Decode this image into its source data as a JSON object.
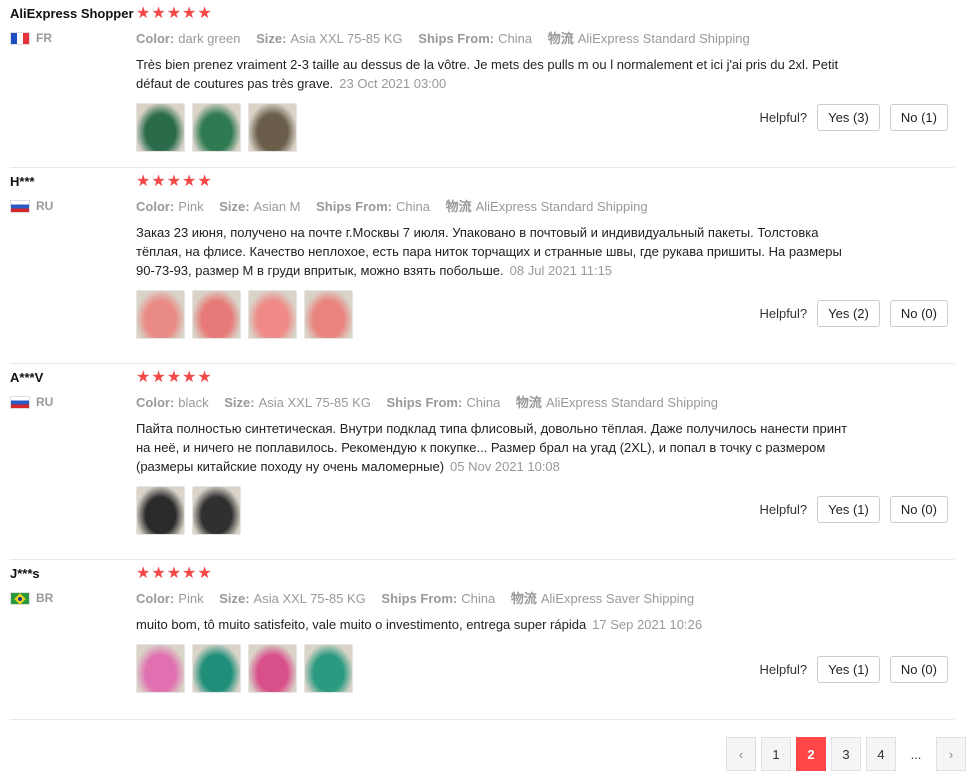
{
  "labels": {
    "color": "Color:",
    "size": "Size:",
    "ships_from": "Ships From:",
    "shipping_icon": "物流",
    "helpful": "Helpful?"
  },
  "star_glyph": "★★★★★",
  "reviews": [
    {
      "user": "AliExpress Shopper",
      "country": "FR",
      "flag": "flag-fr",
      "rating": 5,
      "color": "dark green",
      "size": "Asia XXL 75-85 KG",
      "ships_from": "China",
      "shipping": "AliExpress Standard Shipping",
      "text": "Très bien prenez vraiment 2-3 taille au dessus de la vôtre. Je mets des pulls m ou l normalement et ici j'ai pris du 2xl. Petit défaut de coutures pas très grave.",
      "date": "23 Oct 2021 03:00",
      "yes": "Yes (3)",
      "no": "No (1)",
      "thumbs": [
        "#2a6b4a",
        "#2f7a52",
        "#6a5e4a"
      ]
    },
    {
      "user": "H***",
      "country": "RU",
      "flag": "flag-ru",
      "rating": 5,
      "color": "Pink",
      "size": "Asian M",
      "ships_from": "China",
      "shipping": "AliExpress Standard Shipping",
      "text": "Заказ 23 июня, получено на почте г.Москвы 7 июля. Упаковано в почтовый и индивидуальный пакеты. Толстовка тёплая, на флисе. Качество неплохое, есть пара ниток торчащих и странные швы, где рукава пришиты. На размеры 90-73-93, размер М в груди впритык, можно взять побольше.",
      "date": "08 Jul 2021 11:15",
      "yes": "Yes (2)",
      "no": "No (0)",
      "thumbs": [
        "#e98a84",
        "#e77a78",
        "#ef8a86",
        "#e9837e"
      ]
    },
    {
      "user": "A***V",
      "country": "RU",
      "flag": "flag-ru",
      "rating": 5,
      "color": "black",
      "size": "Asia XXL 75-85 KG",
      "ships_from": "China",
      "shipping": "AliExpress Standard Shipping",
      "text": "Пайта полностью синтетическая. Внутри подклад типа флисовый, довольно тёплая. Даже получилось нанести принт на неё, и ничего не поплавилось. Рекомендую к покупке... Размер брал на угад (2XL), и попал в точку с размером (размеры китайские походу ну очень маломерные)",
      "date": "05 Nov 2021 10:08",
      "yes": "Yes (1)",
      "no": "No (0)",
      "thumbs": [
        "#2b2b2b",
        "#303030"
      ]
    },
    {
      "user": "J***s",
      "country": "BR",
      "flag": "flag-br",
      "rating": 5,
      "color": "Pink",
      "size": "Asia XXL 75-85 KG",
      "ships_from": "China",
      "shipping": "AliExpress Saver Shipping",
      "text": "muito bom, tô muito satisfeito, vale muito o investimento, entrega super rápida",
      "date": "17 Sep 2021 10:26",
      "yes": "Yes (1)",
      "no": "No (0)",
      "thumbs": [
        "#e070b0",
        "#1f8f7a",
        "#d8508a",
        "#2a9a80"
      ]
    }
  ],
  "pagination": {
    "prev": "‹",
    "pages": [
      "1",
      "2",
      "3",
      "4"
    ],
    "current": "2",
    "ellipsis": "...",
    "next": "›"
  }
}
